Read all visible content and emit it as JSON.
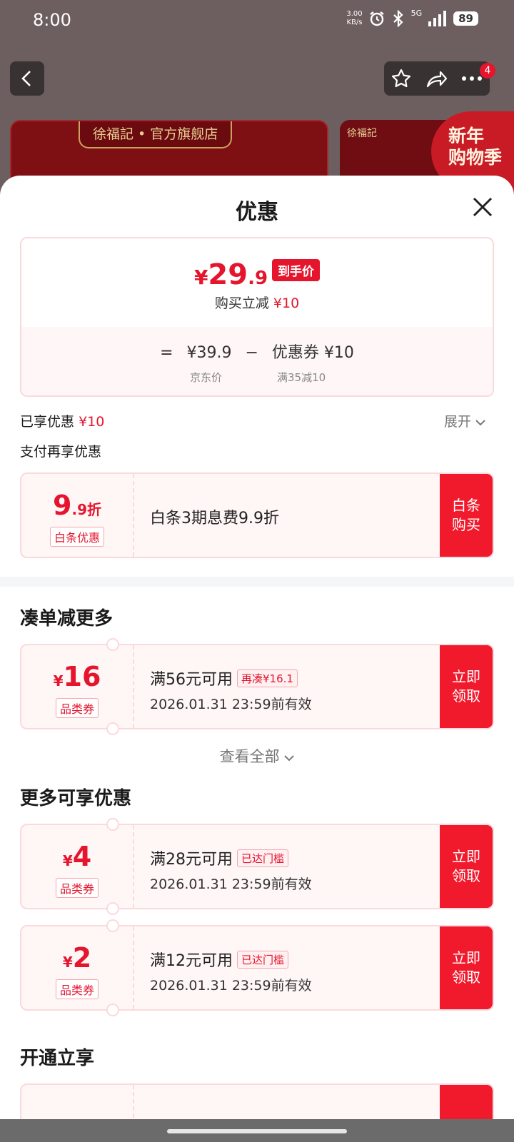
{
  "status_bar": {
    "time": "8:00",
    "net_speed_value": "3.00",
    "net_speed_unit": "KB/s",
    "network": "5G",
    "battery": "89",
    "icons": [
      "alarm-icon",
      "bluetooth-icon",
      "signal-icon",
      "battery-icon"
    ]
  },
  "nav": {
    "badge_count": "4",
    "icons": [
      "back-icon",
      "star-icon",
      "share-icon",
      "more-icon"
    ]
  },
  "banner": {
    "store_tag": "徐福記 • 官方旗舰店",
    "logo_text_2": "徐福記",
    "new_year_badge_line1": "新年",
    "new_year_badge_line2": "购物季"
  },
  "sheet": {
    "title": "优惠",
    "price": {
      "currency": "¥",
      "integer": "29",
      "decimal": ".9",
      "tag": "到手价",
      "instant_off_label": "购买立减",
      "instant_off_amount": "¥10",
      "formula_eq": "=",
      "jd_price": "¥39.9",
      "formula_minus": "−",
      "coupon_part": "优惠券 ¥10",
      "jd_price_label": "京东价",
      "coupon_label": "满35减10"
    },
    "enjoyed_label": "已享优惠",
    "enjoyed_amount": "¥10",
    "expand_label": "展开",
    "pay_more_label": "支付再享优惠",
    "baitiao": {
      "amount_big": "9",
      "amount_small": ".9折",
      "kind": "白条优惠",
      "desc": "白条3期息费9.9折",
      "button": "白条 购买"
    },
    "section_combine": "凑单减更多",
    "combine_coupon": {
      "currency": "¥",
      "amount": "16",
      "kind": "品类券",
      "condition": "满56元可用",
      "chip": "再凑¥16.1",
      "validity": "2026.01.31 23:59前有效",
      "button": "立即 领取"
    },
    "view_all": "查看全部",
    "section_more": "更多可享优惠",
    "more_coupons": [
      {
        "currency": "¥",
        "amount": "4",
        "kind": "品类券",
        "condition": "满28元可用",
        "chip": "已达门槛",
        "validity": "2026.01.31 23:59前有效",
        "button": "立即 领取"
      },
      {
        "currency": "¥",
        "amount": "2",
        "kind": "品类券",
        "condition": "满12元可用",
        "chip": "已达门槛",
        "validity": "2026.01.31 23:59前有效",
        "button": "立即 领取"
      }
    ],
    "section_open": "开通立享"
  },
  "colors": {
    "accent_red": "#e4152d",
    "button_red": "#f01a2c",
    "coupon_bg": "#fff6f6",
    "coupon_border": "#fbd9dc",
    "overlay_bg": "#6d5f60"
  }
}
